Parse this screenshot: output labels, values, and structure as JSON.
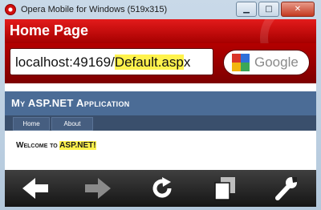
{
  "window": {
    "title": "Opera Mobile for Windows (519x315)",
    "minimize_glyph": "▁",
    "maximize_glyph": "□",
    "close_glyph": "✕"
  },
  "browser": {
    "page_title": "Home Page",
    "address": {
      "prefix": "localhost:49169/",
      "highlighted": "Default.asp",
      "suffix": "x"
    },
    "search": {
      "label": "Google",
      "icon": "google-icon"
    },
    "toolbar": [
      {
        "name": "back",
        "icon": "arrow-left-icon"
      },
      {
        "name": "forward",
        "icon": "arrow-right-icon"
      },
      {
        "name": "reload",
        "icon": "reload-icon"
      },
      {
        "name": "tabs",
        "icon": "tabs-icon"
      },
      {
        "name": "settings",
        "icon": "wrench-icon"
      }
    ]
  },
  "site": {
    "title": "My ASP.NET Application",
    "nav": [
      "Home",
      "About"
    ],
    "welcome_prefix": "Welcome to ",
    "welcome_highlight": "ASP.NET!"
  },
  "colors": {
    "opera_red": "#c40000",
    "highlight": "#fff34d",
    "site_header": "#4b6c96",
    "site_nav": "#3a4f6c"
  }
}
